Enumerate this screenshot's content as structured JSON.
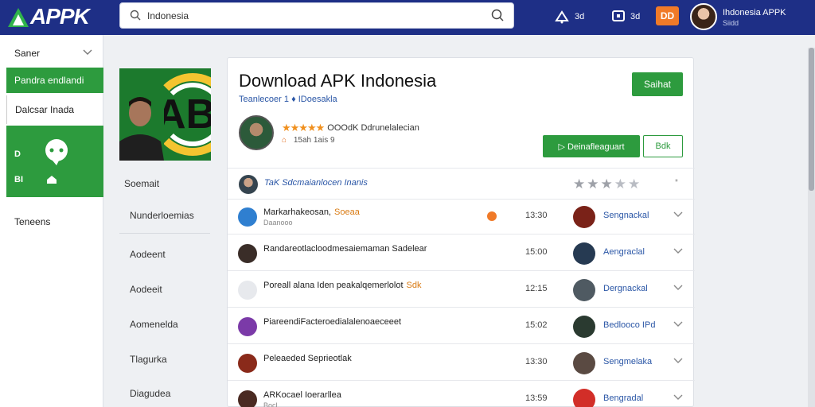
{
  "header": {
    "logo_text": "APPK",
    "search_value": "Indonesia",
    "icon1_label": "3d",
    "icon2_label": "3d",
    "badge_label": "DD",
    "user_name": "Ihdonesia APPK",
    "user_sub": "Siidd"
  },
  "sidebar": {
    "items": [
      {
        "label": "Saner"
      },
      {
        "label": "Pandra endlandi"
      },
      {
        "label": "Dalcsar Inada"
      },
      {
        "label": "Teneens"
      }
    ],
    "promo_label_top": "D",
    "promo_label_bottom": "BI"
  },
  "left_menu": {
    "heading": "Soemait",
    "items": [
      "Nunderloemias",
      "Aodeent",
      "Aodeeit",
      "Aomenelda",
      "Tlagurka",
      "Diagudea"
    ]
  },
  "app": {
    "title": "Download APK Indonesia",
    "subtitle": "Teanlecoer 1",
    "subtitle_link": "IDoesakla",
    "top_button": "Saihat",
    "rating_text": "OOOdK Ddrunelalecian",
    "rating_sub": "15ah 1ais",
    "rating_sub2": "9",
    "download_button": "Deinafleaguart",
    "secondary_button": "Bdk",
    "review_text": "TaK Sdcmaianlocen Inanis",
    "review_x": "*"
  },
  "rows": [
    {
      "name": "Markarhakeosan,",
      "tag": "Soeaa",
      "sub": "Daanooo",
      "time": "13:30",
      "dev": "Sengnackal",
      "has_dot": true,
      "icon_color": "#2f7fd0",
      "avatar_color": "#7a2218"
    },
    {
      "name": "Randareotlacloodmesaiemaman Sadelear",
      "tag": "",
      "sub": "",
      "time": "15:00",
      "dev": "Aengraclal",
      "has_dot": false,
      "icon_color": "#3a2d28",
      "avatar_color": "#263a52"
    },
    {
      "name": "Poreall alana Iden peakalqemerlolot",
      "tag": "Sdk",
      "sub": "",
      "time": "12:15",
      "dev": "Dergnackal",
      "has_dot": false,
      "icon_color": "#e7e9ed",
      "avatar_color": "#4f5a62"
    },
    {
      "name": "PiareendiFacteroedialalenoaeceeet",
      "tag": "",
      "sub": "",
      "time": "15:02",
      "dev": "Bedlooco IPd",
      "has_dot": false,
      "icon_color": "#7b3aa8",
      "avatar_color": "#2a3a30"
    },
    {
      "name": "Peleaeded Seprieotlak",
      "tag": "",
      "sub": "",
      "time": "13:30",
      "dev": "Sengmelaka",
      "has_dot": false,
      "icon_color": "#8a2a1a",
      "avatar_color": "#5a4a42"
    },
    {
      "name": "ARKocael Ioerarllea",
      "tag": "",
      "sub": "Bocl",
      "time": "13:59",
      "dev": "Bengradal",
      "has_dot": false,
      "icon_color": "#4a2a22",
      "avatar_color": "#d22e28"
    }
  ]
}
